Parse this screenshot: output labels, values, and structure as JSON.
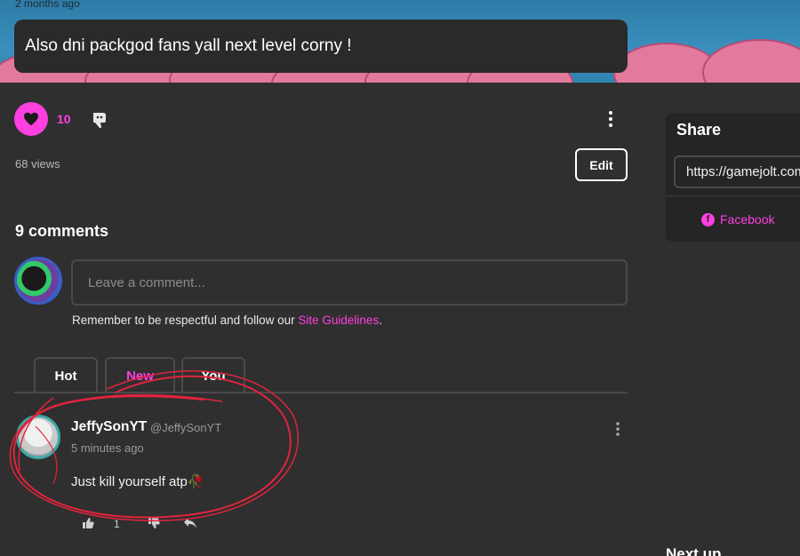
{
  "banner": {
    "timestamp": "2 months ago"
  },
  "post": {
    "message": "Also dni packgod fans yall next level corny !"
  },
  "reactions": {
    "like_count": "10",
    "views": "68 views",
    "edit_label": "Edit"
  },
  "comments": {
    "title": "9 comments",
    "input_placeholder": "Leave a comment...",
    "guidelines_prefix": "Remember to be respectful and follow our ",
    "guidelines_link": "Site Guidelines",
    "guidelines_suffix": ".",
    "tabs": [
      {
        "label": "Hot"
      },
      {
        "label": "New"
      },
      {
        "label": "You"
      }
    ],
    "active_tab": "New",
    "items": [
      {
        "display_name": "JeffySonYT",
        "handle": "@JeffySonYT",
        "time": "5 minutes ago",
        "text": "Just kill yourself atp🥀",
        "like_count": "1"
      }
    ]
  },
  "share": {
    "title": "Share",
    "url": "https://gamejolt.com",
    "facebook_label": "Facebook"
  },
  "sidebar": {
    "next_up": "Next up"
  },
  "colors": {
    "accent": "#ff3fe0",
    "background": "#2f2f2f",
    "annotation": "#e0243c"
  },
  "icons": [
    "heart-icon",
    "dislike-icon",
    "more-vertical-icon",
    "facebook-icon",
    "thumbs-up-icon",
    "thumbs-down-icon",
    "reply-icon"
  ]
}
